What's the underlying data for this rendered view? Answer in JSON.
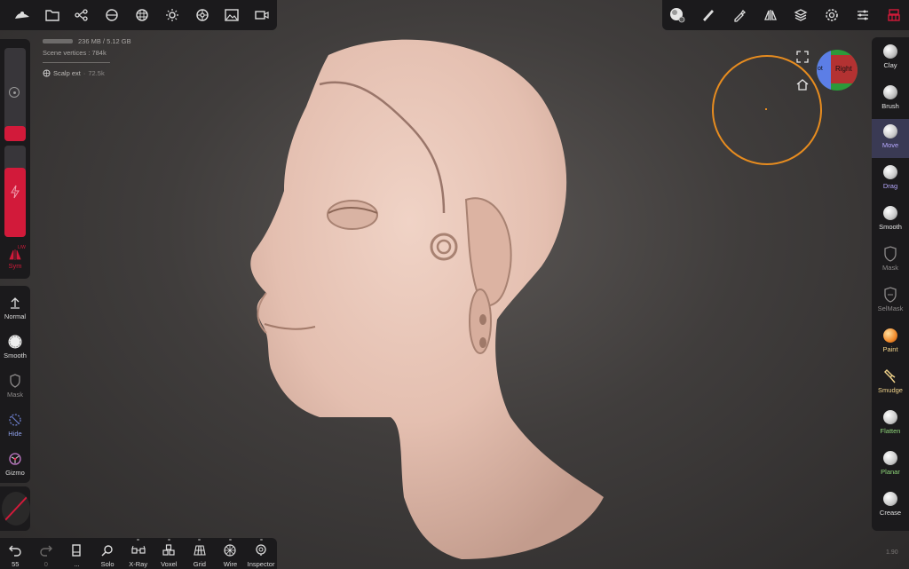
{
  "colors": {
    "panel_bg": "#1b1a1c",
    "accent_red": "#d21a3a",
    "brush_orange": "#e78c1f",
    "active_tool_bg": "#3a3a54",
    "model_skin": "#e7c3b4"
  },
  "top_left_toolbar": {
    "icons": [
      "nomad-logo-icon",
      "folder-icon",
      "scene-graph-icon",
      "camera-icon",
      "grid-globe-icon",
      "sun-icon",
      "material-ball-icon",
      "image-icon",
      "video-icon"
    ]
  },
  "top_right_toolbar": {
    "icons": [
      "material-preview-icon",
      "brush-stroke-icon",
      "picker-icon",
      "symmetry-icon",
      "layers-icon",
      "settings-icon",
      "sliders-icon",
      "tools-icon"
    ]
  },
  "stats": {
    "memory": "236 MB / 5.12 GB",
    "scene_vertices_label": "Scene vertices :",
    "scene_vertices_value": "784k",
    "object_name": "Scalp ext",
    "object_vertices": "72.5k"
  },
  "left_panel": {
    "sym_label": "Sym",
    "sym_badge": "L/W",
    "normal_label": "Normal",
    "smooth_label": "Smooth",
    "mask_label": "Mask",
    "hide_label": "Hide",
    "gizmo_label": "Gizmo"
  },
  "right_tools": [
    {
      "label": "Clay",
      "color": "#e2e2e2",
      "ball": "#d8d8d8",
      "active": false
    },
    {
      "label": "Brush",
      "color": "#e2e2e2",
      "ball": "#d8d8d8",
      "active": false
    },
    {
      "label": "Move",
      "color": "#b7a9ff",
      "ball": "#e8e8e8",
      "active": true
    },
    {
      "label": "Drag",
      "color": "#b7a9ff",
      "ball": "#e8e8e8",
      "active": false
    },
    {
      "label": "Smooth",
      "color": "#e2e2e2",
      "ball": "#d8d8d8",
      "active": false
    },
    {
      "label": "Mask",
      "color": "#8d8a8a",
      "ball": null,
      "active": false
    },
    {
      "label": "SelMask",
      "color": "#8d8a8a",
      "ball": null,
      "active": false
    },
    {
      "label": "Paint",
      "color": "#f1d38a",
      "ball": "#f28a2a",
      "active": false
    },
    {
      "label": "Smudge",
      "color": "#f1d38a",
      "ball": null,
      "active": false
    },
    {
      "label": "Flatten",
      "color": "#8fd67a",
      "ball": "#e8e8e8",
      "active": false
    },
    {
      "label": "Planar",
      "color": "#8fd67a",
      "ball": "#e8e8e8",
      "active": false
    },
    {
      "label": "Crease",
      "color": "#e2e2e2",
      "ball": "#e8e8e8",
      "active": false
    }
  ],
  "bottom_bar": [
    {
      "label": "55",
      "icon": "undo-icon"
    },
    {
      "label": "0",
      "icon": "redo-icon"
    },
    {
      "label": "...",
      "icon": "book-icon"
    },
    {
      "label": "Solo",
      "icon": "search-icon"
    },
    {
      "label": "X-Ray",
      "icon": "xray-glasses-icon"
    },
    {
      "label": "Voxel",
      "icon": "voxel-icon"
    },
    {
      "label": "Grid",
      "icon": "grid-icon"
    },
    {
      "label": "Wire",
      "icon": "wireframe-icon"
    },
    {
      "label": "Inspector",
      "icon": "inspector-icon"
    }
  ],
  "gizmo_cube": {
    "right_label": "Right",
    "left_label": "ot"
  },
  "version": "1.90"
}
